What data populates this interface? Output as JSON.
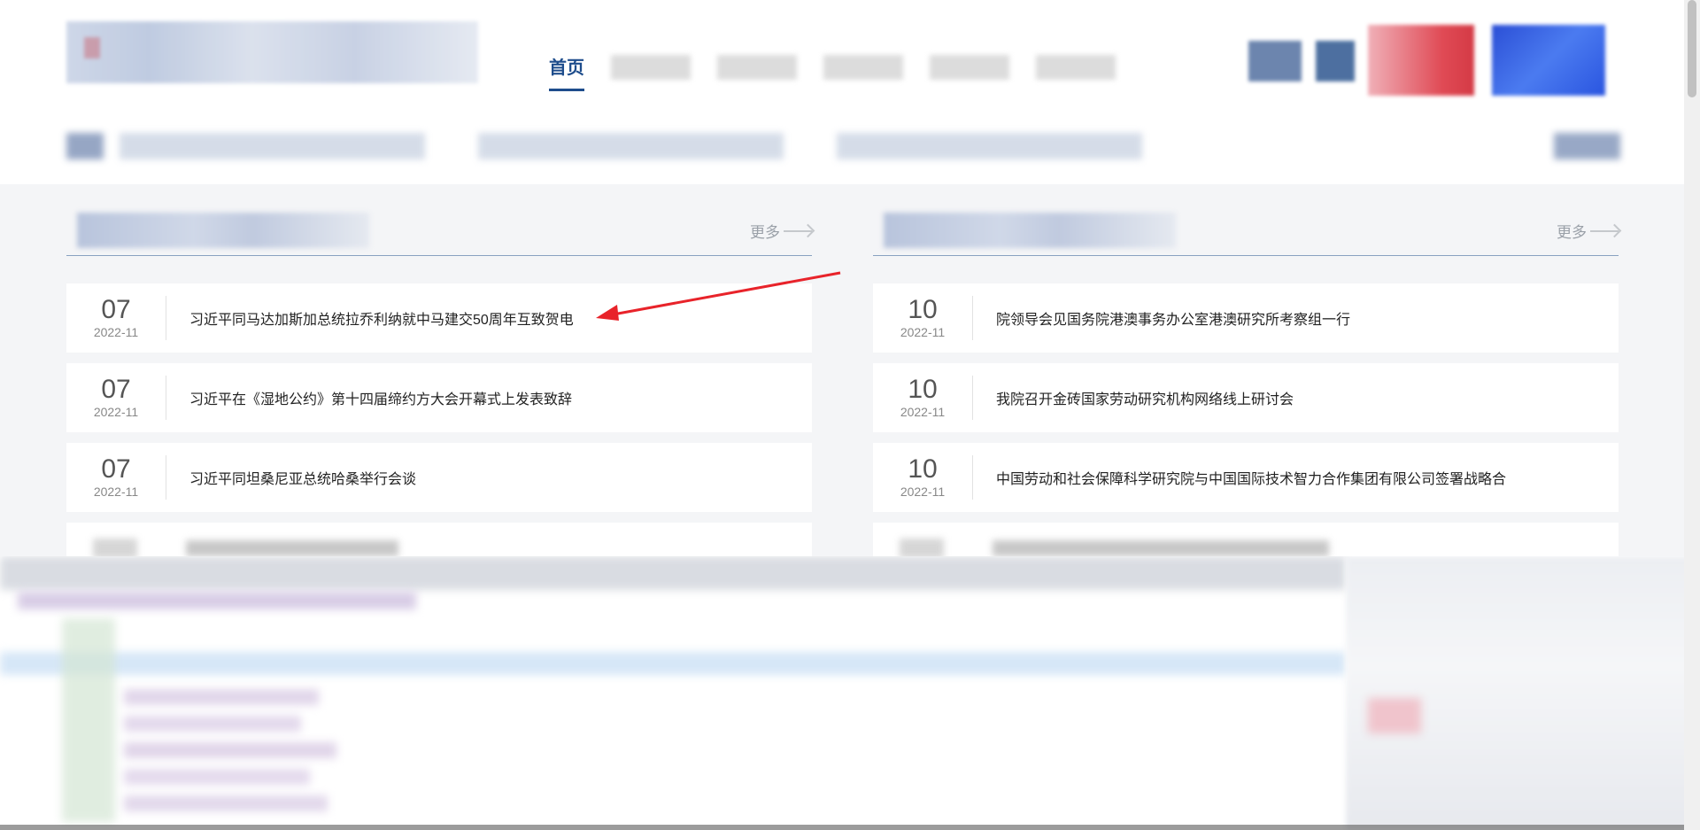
{
  "nav": {
    "home_label": "首页"
  },
  "left_panel": {
    "more_label": "更多",
    "items": [
      {
        "day": "07",
        "ym": "2022-11",
        "title": "习近平同马达加斯加总统拉乔利纳就中马建交50周年互致贺电"
      },
      {
        "day": "07",
        "ym": "2022-11",
        "title": "习近平在《湿地公约》第十四届缔约方大会开幕式上发表致辞"
      },
      {
        "day": "07",
        "ym": "2022-11",
        "title": "习近平同坦桑尼亚总统哈桑举行会谈"
      }
    ]
  },
  "right_panel": {
    "more_label": "更多",
    "items": [
      {
        "day": "10",
        "ym": "2022-11",
        "title": "院领导会见国务院港澳事务办公室港澳研究所考察组一行"
      },
      {
        "day": "10",
        "ym": "2022-11",
        "title": "我院召开金砖国家劳动研究机构网络线上研讨会"
      },
      {
        "day": "10",
        "ym": "2022-11",
        "title": "中国劳动和社会保障科学研究院与中国国际技术智力合作集团有限公司签署战略合"
      }
    ]
  },
  "colors": {
    "brand": "#1e4d8c",
    "annotation_arrow": "#e8232a"
  }
}
